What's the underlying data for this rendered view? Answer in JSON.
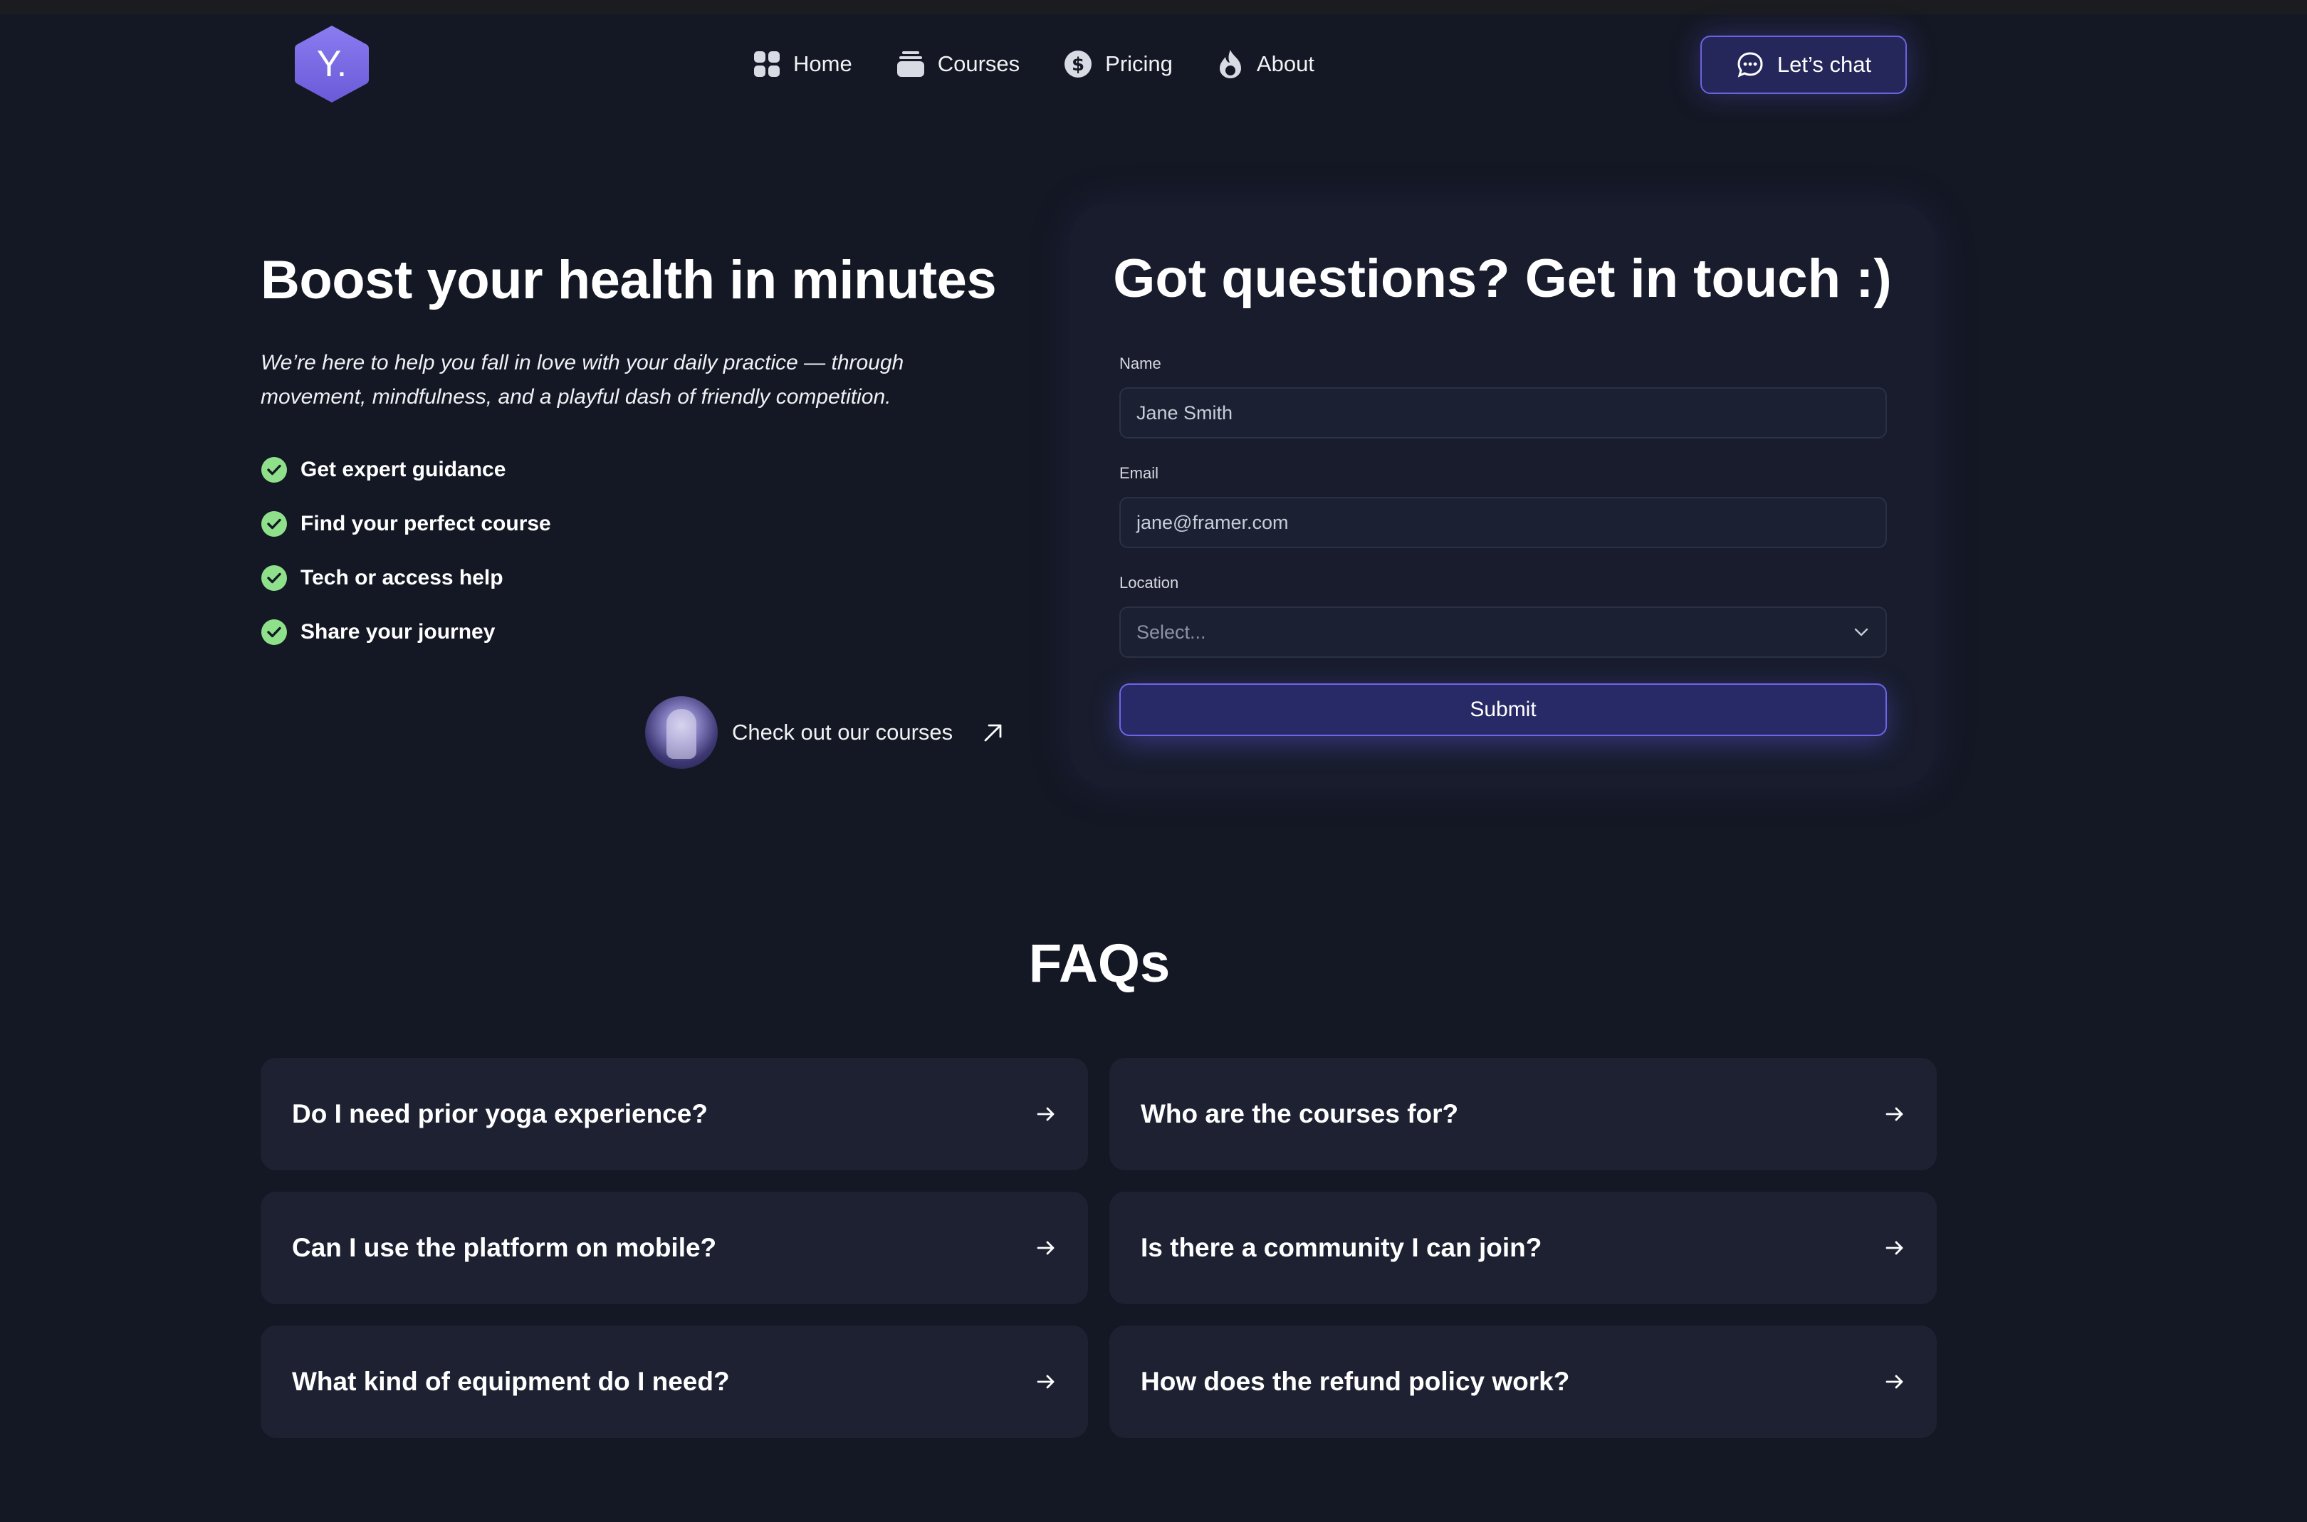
{
  "brand": {
    "logo_text": "Y.",
    "accent": "#7a6ce8"
  },
  "nav": {
    "items": [
      {
        "label": "Home",
        "icon": "grid-icon"
      },
      {
        "label": "Courses",
        "icon": "stack-icon"
      },
      {
        "label": "Pricing",
        "icon": "dollar-icon"
      },
      {
        "label": "About",
        "icon": "flame-icon"
      }
    ],
    "cta_label": "Let’s chat"
  },
  "hero": {
    "title": "Boost your health in minutes",
    "subtitle": "We’re here to help you fall in love with your daily practice — through movement, mindfulness, and a playful dash of friendly competition.",
    "checklist": [
      "Get expert guidance",
      "Find your perfect course",
      "Tech or access help",
      "Share your journey"
    ],
    "courses_link": "Check out our courses"
  },
  "contact": {
    "title": "Got questions? Get in touch :)",
    "name_label": "Name",
    "name_value": "Jane Smith",
    "email_label": "Email",
    "email_value": "jane@framer.com",
    "location_label": "Location",
    "location_placeholder": "Select...",
    "submit_label": "Submit"
  },
  "faq": {
    "title": "FAQs",
    "items": [
      "Do I need prior yoga experience?",
      "Who are the courses for?",
      "Can I use the platform on mobile?",
      "Is there a community I can join?",
      "What kind of equipment do I need?",
      "How does the refund policy work?"
    ]
  },
  "colors": {
    "background": "#141824",
    "card": "#181c2c",
    "check": "#8fe08a",
    "button": "#272a66"
  }
}
